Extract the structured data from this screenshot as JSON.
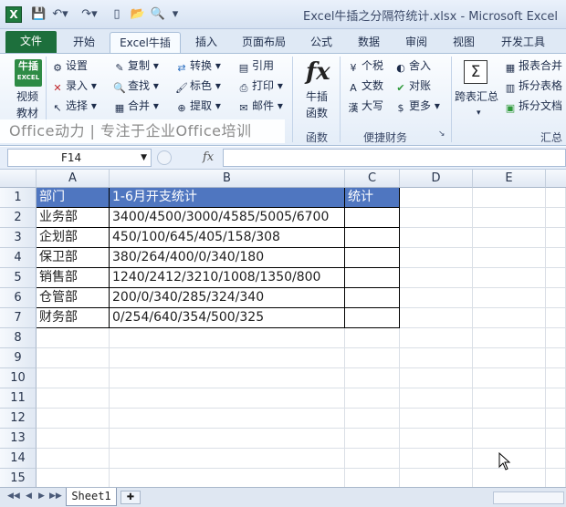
{
  "window": {
    "title": "Excel牛插之分隔符统计.xlsx - Microsoft Excel",
    "app_icon": "X",
    "quick_access": [
      "save-icon",
      "undo-icon",
      "redo-icon",
      "new-icon",
      "open-icon",
      "print-preview-icon",
      "customize-icon"
    ]
  },
  "tabs": [
    "文件",
    "开始",
    "Excel牛插",
    "插入",
    "页面布局",
    "公式",
    "数据",
    "审阅",
    "视图",
    "开发工具"
  ],
  "active_tab": "Excel牛插",
  "ribbon": {
    "niu_icon_top": "牛插",
    "niu_icon_sub": "EXCEL",
    "video_label_1": "视频",
    "video_label_2": "教材",
    "btn_settings": "设置",
    "btn_record": "录入",
    "btn_select": "选择",
    "btn_copy": "复制",
    "btn_find": "查找",
    "btn_merge": "合并",
    "btn_convert": "转换",
    "btn_color": "标色",
    "btn_extract": "提取",
    "btn_quote": "引用",
    "btn_print": "打印",
    "btn_mail": "邮件",
    "fx_label_1": "牛插",
    "fx_label_2": "函数",
    "btn_tax": "个税",
    "btn_text": "文数",
    "btn_upper": "大写",
    "btn_round": "舍入",
    "btn_check": "对账",
    "btn_more": "更多",
    "btn_sum_label": "跨表汇总",
    "btn_report_merge": "报表合并",
    "btn_split_table": "拆分表格",
    "btn_split_doc": "拆分文档",
    "group_functions": "函数",
    "group_finance": "便捷财务",
    "group_summary": "汇总",
    "banner": "Office动力 | 专注于企业Office培训"
  },
  "formula_bar": {
    "name_box": "F14",
    "fx": "fx",
    "formula": ""
  },
  "columns": [
    "A",
    "B",
    "C",
    "D",
    "E"
  ],
  "rows": [
    "1",
    "2",
    "3",
    "4",
    "5",
    "6",
    "7",
    "8",
    "9",
    "10",
    "11",
    "12",
    "13",
    "14",
    "15"
  ],
  "table": {
    "header": [
      "部门",
      "1-6月开支统计",
      "统计"
    ],
    "data": [
      [
        "业务部",
        "3400/4500/3000/4585/5005/6700",
        ""
      ],
      [
        "企划部",
        "450/100/645/405/158/308",
        ""
      ],
      [
        "保卫部",
        "380/264/400/0/340/180",
        ""
      ],
      [
        "销售部",
        "1240/2412/3210/1008/1350/800",
        ""
      ],
      [
        "仓管部",
        "200/0/340/285/324/340",
        ""
      ],
      [
        "财务部",
        "0/254/640/354/500/325",
        ""
      ]
    ]
  },
  "sheet_tabs": [
    "Sheet1"
  ],
  "colors": {
    "header_fill": "#4f76c0",
    "file_tab": "#1d6f3c"
  }
}
